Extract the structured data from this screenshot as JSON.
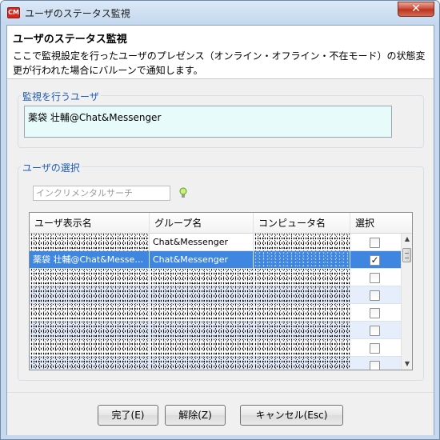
{
  "window": {
    "title": "ユーザのステータス監視",
    "app_icon_text": "CM",
    "close_glyph": "✕"
  },
  "header": {
    "title": "ユーザのステータス監視",
    "description": "ここで監視設定を行ったユーザのプレゼンス（オンライン・オフライン・不在モード）の状態変更が行われた場合にバルーンで通知します。"
  },
  "monitor": {
    "label": "監視を行うユーザ",
    "value": "薬袋 壮輔@Chat&Messenger"
  },
  "selection": {
    "label": "ユーザの選択",
    "search_placeholder": "インクリメンタルサーチ",
    "columns": [
      "ユーザ表示名",
      "グループ名",
      "コンピュータ名",
      "選択"
    ],
    "rows": [
      {
        "name": "",
        "group": "Chat&Messenger",
        "computer": "",
        "checked": false,
        "selected": false
      },
      {
        "name": "薬袋 壮輔@Chat&Messe…",
        "group": "Chat&Messenger",
        "computer": "",
        "checked": true,
        "selected": true
      },
      {
        "name": "",
        "group": "",
        "computer": "",
        "checked": false,
        "selected": false
      },
      {
        "name": "",
        "group": "",
        "computer": "",
        "checked": false,
        "selected": false
      },
      {
        "name": "",
        "group": "",
        "computer": "",
        "checked": false,
        "selected": false
      },
      {
        "name": "",
        "group": "",
        "computer": "",
        "checked": false,
        "selected": false
      },
      {
        "name": "",
        "group": "",
        "computer": "",
        "checked": false,
        "selected": false
      },
      {
        "name": "",
        "group": "",
        "computer": "",
        "checked": false,
        "selected": false
      }
    ],
    "check_glyph": "✓"
  },
  "buttons": {
    "complete": "完了(E)",
    "clear": "解除(Z)",
    "cancel": "キャンセル(Esc)"
  }
}
